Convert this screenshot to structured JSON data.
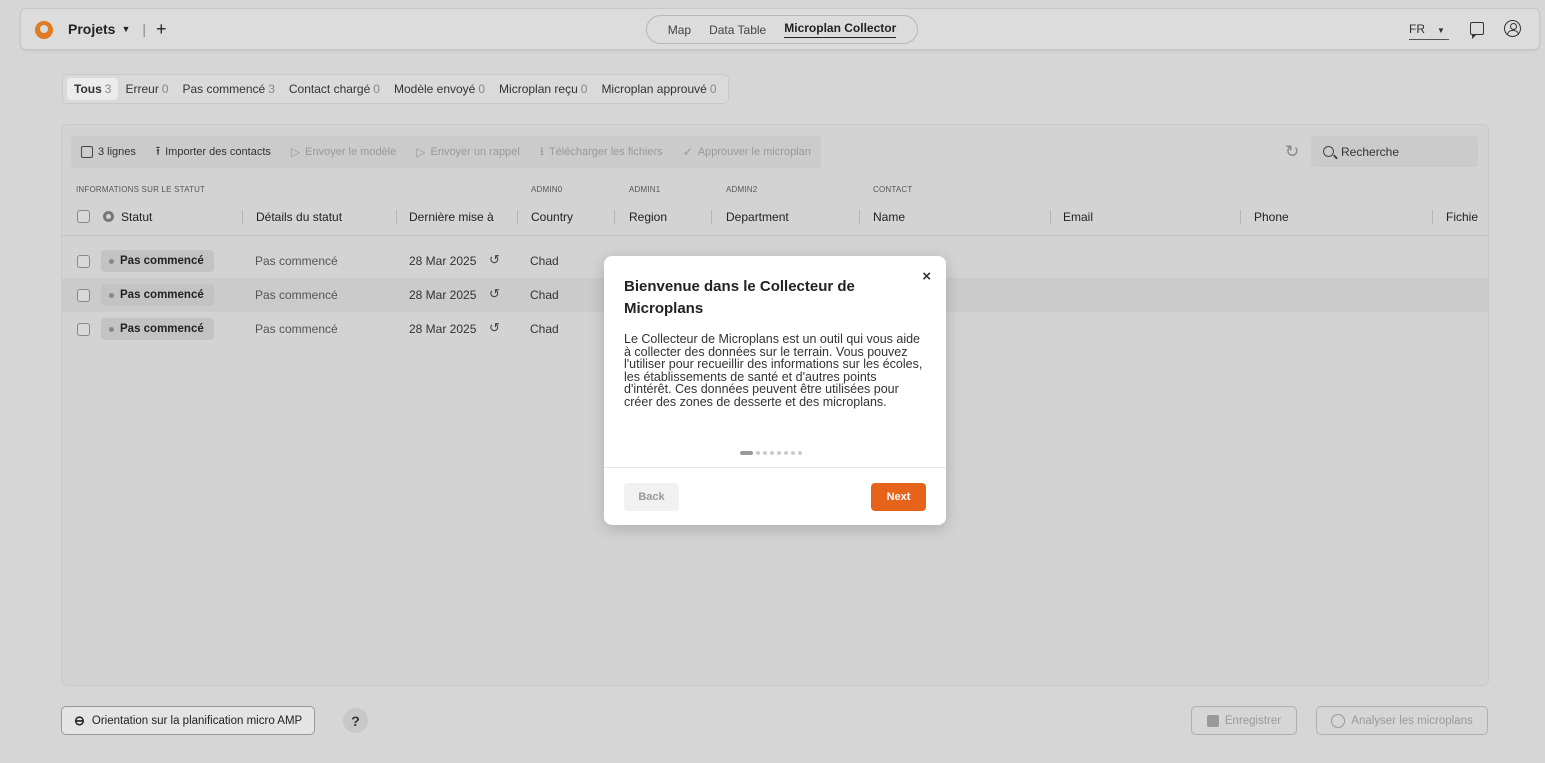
{
  "header": {
    "projects_label": "Projets",
    "nav": [
      "Map",
      "Data Table",
      "Microplan Collector"
    ],
    "nav_active": "Microplan Collector",
    "lang": "FR"
  },
  "filters": [
    {
      "label": "Tous",
      "count": "3"
    },
    {
      "label": "Erreur",
      "count": "0"
    },
    {
      "label": "Pas commencé",
      "count": "3"
    },
    {
      "label": "Contact chargé",
      "count": "0"
    },
    {
      "label": "Modèle envoyé",
      "count": "0"
    },
    {
      "label": "Microplan reçu",
      "count": "0"
    },
    {
      "label": "Microplan approuvé",
      "count": "0"
    }
  ],
  "toolbar": {
    "lines": "3 lignes",
    "import": "Importer des contacts",
    "send_model": "Envoyer le modèle",
    "send_reminder": "Envoyer un rappel",
    "download": "Télécharger les fichiers",
    "approve": "Approuver le microplan",
    "search_placeholder": "Recherche"
  },
  "table": {
    "groups": {
      "status_info": "INFORMATIONS SUR LE STATUT",
      "admin0": "ADMIN0",
      "admin1": "ADMIN1",
      "admin2": "ADMIN2",
      "contact": "CONTACT"
    },
    "columns": {
      "status": "Statut",
      "details": "Détails du statut",
      "updated": "Dernière mise à",
      "country": "Country",
      "region": "Region",
      "department": "Department",
      "name": "Name",
      "email": "Email",
      "phone": "Phone",
      "file": "Fichie"
    },
    "rows": [
      {
        "status": "Pas commencé",
        "details": "Pas commencé",
        "date": "28 Mar 2025",
        "country": "Chad"
      },
      {
        "status": "Pas commencé",
        "details": "Pas commencé",
        "date": "28 Mar 2025",
        "country": "Chad"
      },
      {
        "status": "Pas commencé",
        "details": "Pas commencé",
        "date": "28 Mar 2025",
        "country": "Chad"
      }
    ]
  },
  "footer": {
    "orientation": "Orientation sur la planification micro AMP",
    "help": "?",
    "save": "Enregistrer",
    "analyze": "Analyser les microplans"
  },
  "modal": {
    "title": "Bienvenue dans le Collecteur de Microplans",
    "body": "Le Collecteur de Microplans est un outil qui vous aide à collecter des données sur le terrain. Vous pouvez l'utiliser pour recueillir des informations sur les écoles, les établissements de santé et d'autres points d'intérêt. Ces données peuvent être utilisées pour créer des zones de desserte et des microplans.",
    "back": "Back",
    "next": "Next",
    "close": "×",
    "step_current": 1,
    "step_total": 8
  }
}
